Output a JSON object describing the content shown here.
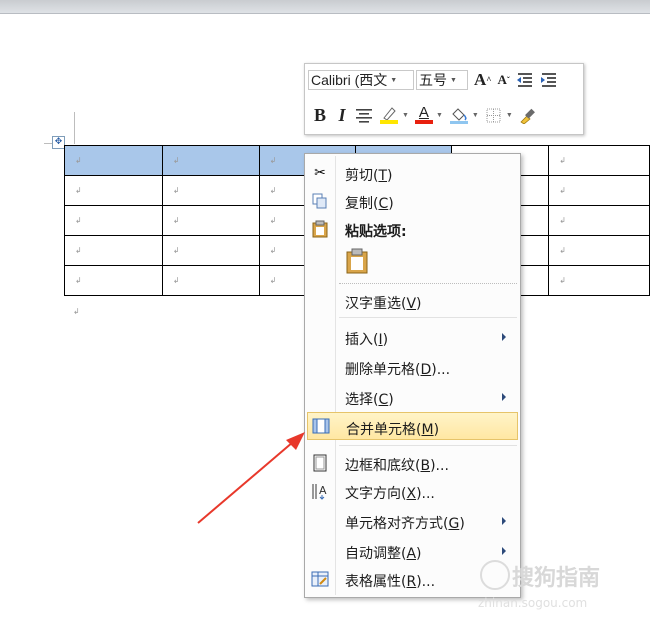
{
  "mini_toolbar": {
    "font_name": "Calibri (西文",
    "font_size": "五号",
    "grow_font": "A",
    "shrink_font": "A",
    "bold": "B",
    "italic": "I",
    "font_color_letter": "A",
    "font_color": "#e8200e",
    "highlight_color": "#ffe600"
  },
  "table": {
    "rows": [
      [
        "↲",
        "↲",
        "↲",
        "↲",
        "↲",
        "↲"
      ],
      [
        "↲",
        "↲",
        "↲",
        "↲",
        "↲",
        "↲"
      ],
      [
        "↲",
        "↲",
        "↲",
        "↲",
        "↲",
        "↲"
      ],
      [
        "↲",
        "↲",
        "↲",
        "↲",
        "↲",
        "↲"
      ],
      [
        "↲",
        "↲",
        "↲",
        "↲",
        "↲",
        "↲"
      ]
    ],
    "paragraph_mark": "↲"
  },
  "context_menu": {
    "cut": {
      "text": "剪切(",
      "key": "T",
      "end": ")"
    },
    "copy": {
      "text": "复制(",
      "key": "C",
      "end": ")"
    },
    "paste_options": "粘贴选项:",
    "reconvert": {
      "text": "汉字重选(",
      "key": "V",
      "end": ")"
    },
    "insert": {
      "text": "插入(",
      "key": "I",
      "end": ")"
    },
    "delete_cells": {
      "text": "删除单元格(",
      "key": "D",
      "end": ")..."
    },
    "select": {
      "text": "选择(",
      "key": "C",
      "end": ")"
    },
    "merge_cells": {
      "text": "合并单元格(",
      "key": "M",
      "end": ")"
    },
    "borders_shading": {
      "text": "边框和底纹(",
      "key": "B",
      "end": ")..."
    },
    "text_direction": {
      "text": "文字方向(",
      "key": "X",
      "end": ")..."
    },
    "cell_alignment": {
      "text": "单元格对齐方式(",
      "key": "G",
      "end": ")"
    },
    "autofit": {
      "text": "自动调整(",
      "key": "A",
      "end": ")"
    },
    "table_properties": {
      "text": "表格属性(",
      "key": "R",
      "end": ")..."
    }
  },
  "watermark": {
    "text": "搜狗指南",
    "sub": "zhinan.sogou.com"
  },
  "colors": {
    "selection": "#a9c7ea",
    "highlight_item": "#ffe7a3",
    "annotation_arrow": "#e8382b"
  }
}
